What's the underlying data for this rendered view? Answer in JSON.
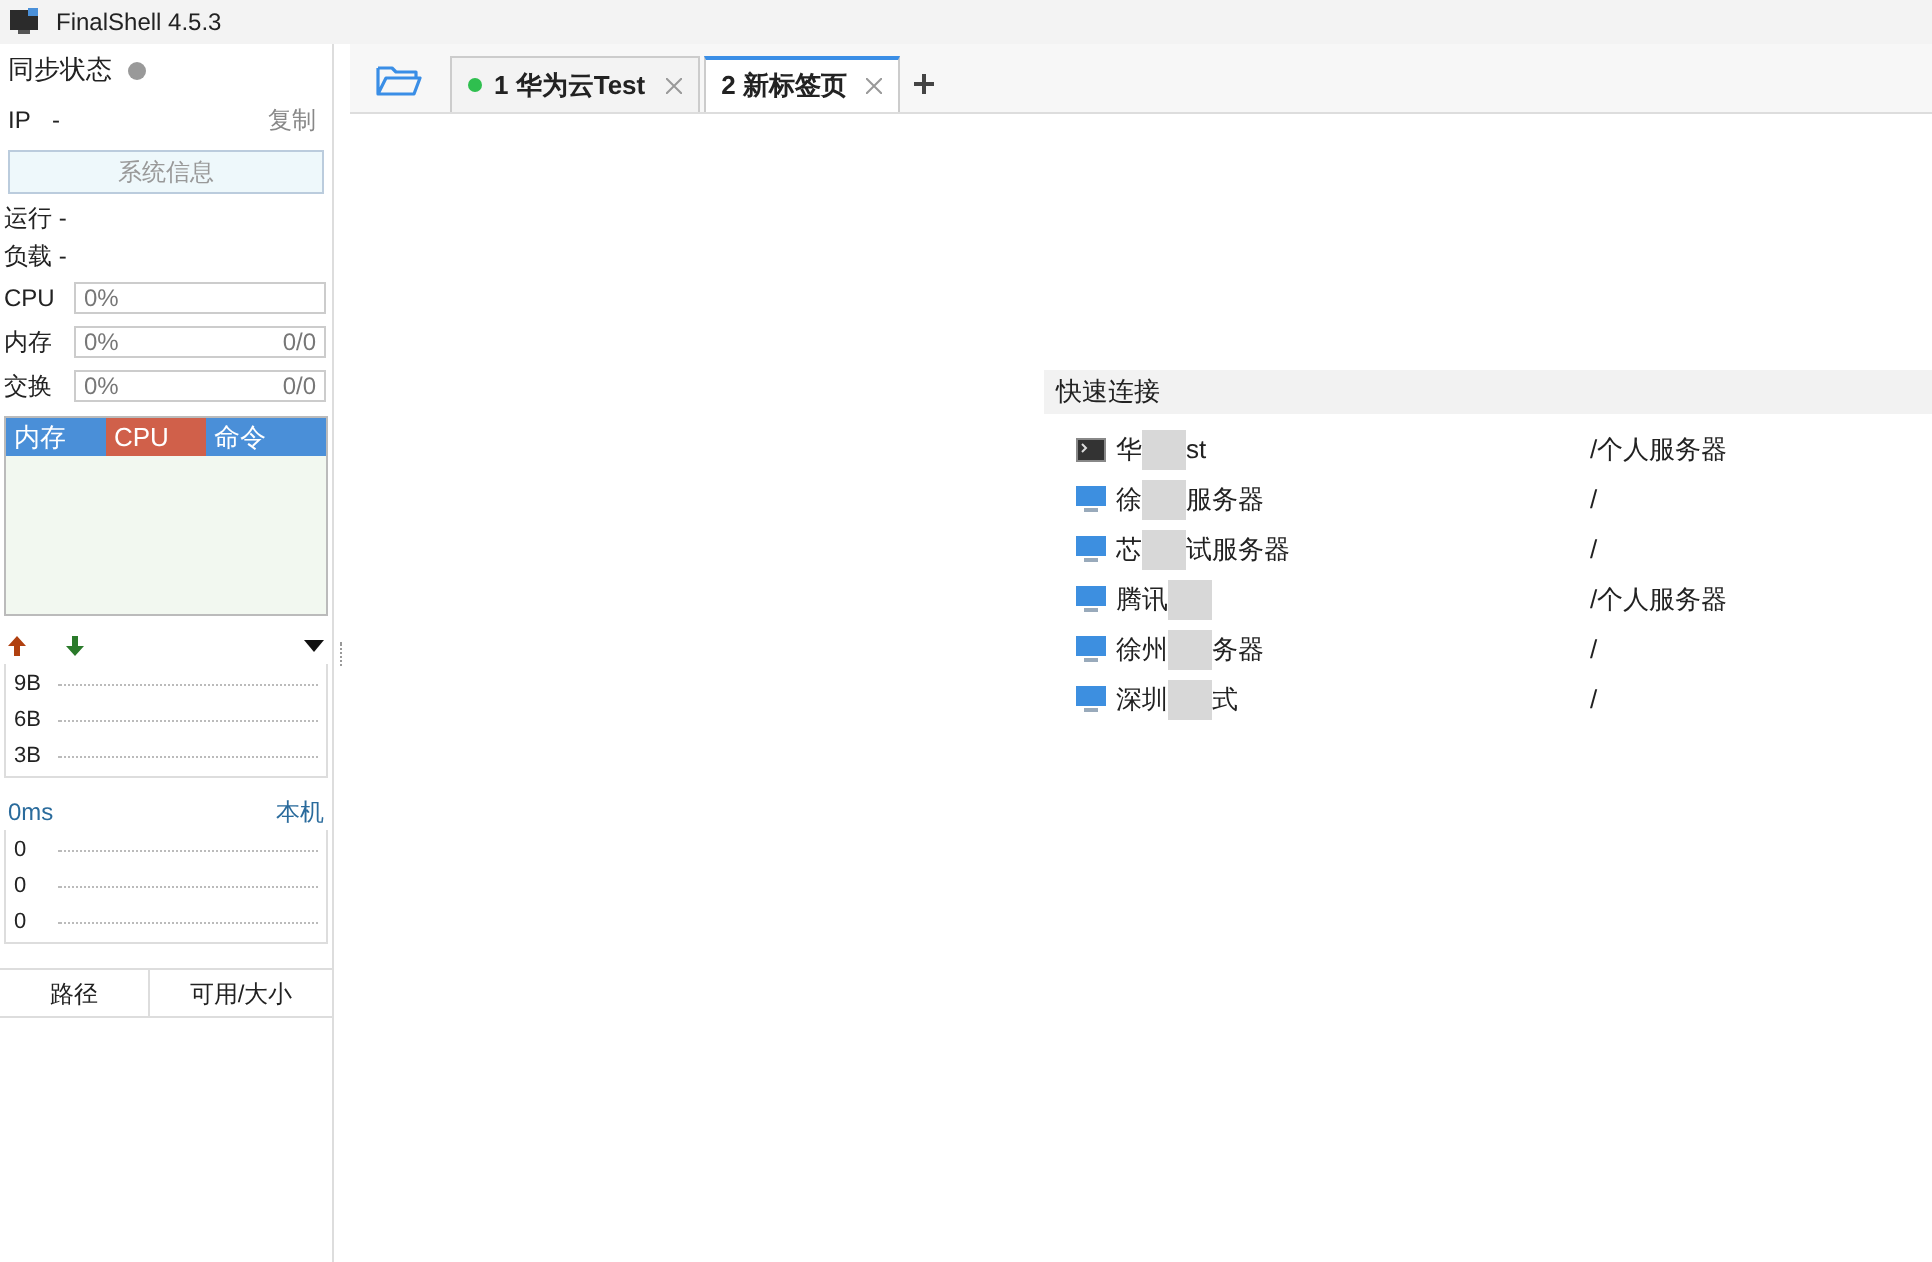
{
  "window": {
    "title": "FinalShell 4.5.3"
  },
  "sidebar": {
    "sync_label": "同步状态",
    "ip_label": "IP",
    "ip_value": "-",
    "copy_label": "复制",
    "sysinfo_button": "系统信息",
    "run_label": "运行 -",
    "load_label": "负载 -",
    "meters": [
      {
        "label": "CPU",
        "percent": "0%",
        "level": 0
      },
      {
        "label": "内存",
        "percent": "0%",
        "ratio": "0/0",
        "level": 0
      },
      {
        "label": "交换",
        "percent": "0%",
        "ratio": "0/0",
        "level": 0
      }
    ],
    "process_tabs": [
      {
        "label": "内存",
        "selected": false
      },
      {
        "label": "CPU",
        "selected": true
      },
      {
        "label": "命令",
        "selected": false
      }
    ],
    "net_ticks": [
      "9B",
      "6B",
      "3B"
    ],
    "ping": {
      "latency": "0ms",
      "host": "本机",
      "ticks": [
        "0",
        "0",
        "0"
      ]
    },
    "disk_columns": [
      "路径",
      "可用/大小"
    ]
  },
  "tabs": [
    {
      "label": "1 华为云Test",
      "connected": true,
      "selected": false
    },
    {
      "label": "2 新标签页",
      "connected": false,
      "selected": true
    }
  ],
  "quick_connect": {
    "title": "快速连接",
    "items": [
      {
        "kind": "terminal",
        "name_start": "华",
        "name_end": "st",
        "path": "/个人服务器"
      },
      {
        "kind": "monitor",
        "name_start": "徐",
        "name_end": "服务器",
        "path": "/"
      },
      {
        "kind": "monitor",
        "name_start": "芯",
        "name_end": "试服务器",
        "path": "/"
      },
      {
        "kind": "monitor",
        "name_start": "腾讯",
        "path": "/个人服务器"
      },
      {
        "kind": "monitor",
        "name_start": "徐州",
        "name_end": "务器",
        "path": "/"
      },
      {
        "kind": "monitor",
        "name_start": "深圳",
        "name_end": "式",
        "path": "/"
      }
    ]
  }
}
